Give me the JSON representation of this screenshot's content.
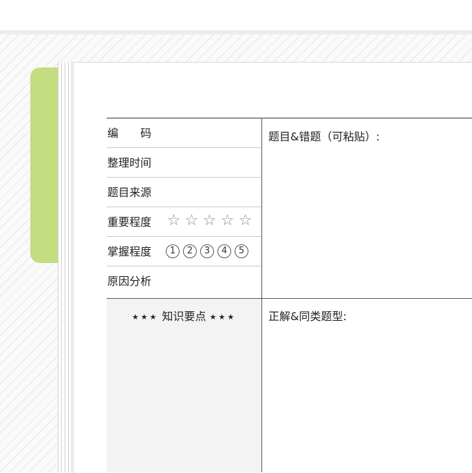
{
  "form": {
    "rows": [
      {
        "label": "编　　码"
      },
      {
        "label": "整理时间"
      },
      {
        "label": "题目来源"
      },
      {
        "label": "重要程度",
        "stars": [
          "☆",
          "☆",
          "☆",
          "☆",
          "☆"
        ]
      },
      {
        "label": "掌握程度",
        "levels": [
          "1",
          "2",
          "3",
          "4",
          "5"
        ]
      },
      {
        "label": "原因分析"
      }
    ],
    "question_title": "题目&错题（可粘贴）:",
    "knowledge": {
      "deco_left": "★★★",
      "title": "知识要点",
      "deco_right": "★★★"
    },
    "answer_title": "正解&同类题型:"
  },
  "colors": {
    "tab_green": "#c3dd81",
    "knowledge_bg": "#f3f3f3"
  }
}
